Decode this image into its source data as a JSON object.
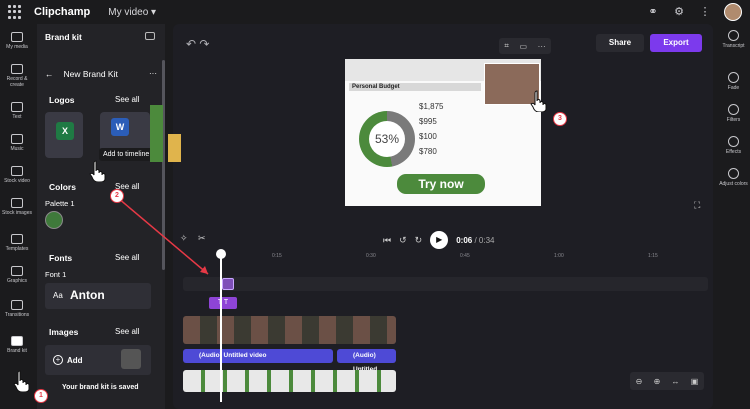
{
  "app": {
    "title": "Clipchamp",
    "video_name": "My video ▾"
  },
  "leftnav": {
    "items": [
      "My media",
      "Record & create",
      "Text",
      "Music",
      "Stock video",
      "Stock images",
      "Templates",
      "Graphics",
      "Transitions",
      "Brand kit"
    ]
  },
  "panel": {
    "title": "Brand kit",
    "sub_title": "New Brand Kit",
    "logos": {
      "heading": "Logos",
      "see_all": "See all"
    },
    "tooltip": "Add to timeline",
    "colors": {
      "heading": "Colors",
      "see_all": "See all",
      "palette": "Palette 1",
      "swatch": "#3f7a3b"
    },
    "fonts": {
      "heading": "Fonts",
      "see_all": "See all",
      "font_label": "Font 1",
      "aa": "Aa",
      "font_name": "Anton"
    },
    "images": {
      "heading": "Images",
      "see_all": "See all",
      "add": "Add"
    },
    "saved": "Your brand kit is saved"
  },
  "toolbar": {
    "share": "Share",
    "export": "Export"
  },
  "preview": {
    "sheet_title": "Personal Budget",
    "donut_label": "53%",
    "values": [
      "$1,875",
      "$995",
      "$100",
      "$780"
    ],
    "cta": "Try now"
  },
  "player": {
    "current": "0:06",
    "total": "/ 0:34"
  },
  "ruler": [
    "0:15",
    "0:30",
    "0:45",
    "1:00",
    "1:15"
  ],
  "tracks": {
    "audio_label_1": "(Audio) Untitled video",
    "audio_label_2": "(Audio) Untitled"
  },
  "rightnav": {
    "items": [
      "Transcript",
      "Fade",
      "Filters",
      "Effects",
      "Adjust colors"
    ]
  },
  "steps": [
    "1",
    "2",
    "3"
  ],
  "accent": "#7c3aed"
}
